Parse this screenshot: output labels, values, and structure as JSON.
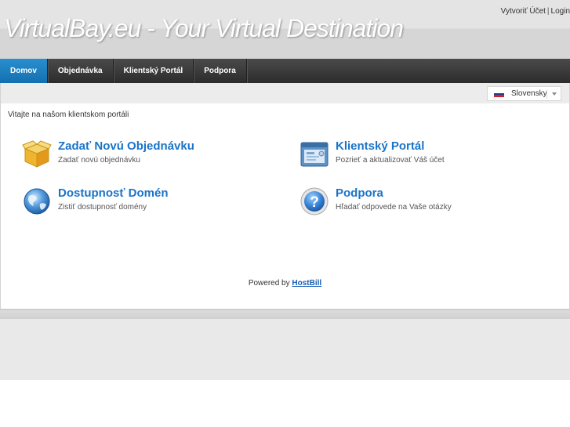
{
  "header": {
    "site_title": "VirtualBay.eu - Your Virtual Destination",
    "top_links": {
      "register": "Vytvoriť Účet",
      "separator": "|",
      "login": "Login"
    }
  },
  "nav": {
    "items": [
      {
        "label": "Domov",
        "active": true
      },
      {
        "label": "Objednávka",
        "active": false
      },
      {
        "label": "Klientský Portál",
        "active": false
      },
      {
        "label": "Podpora",
        "active": false
      }
    ]
  },
  "language": {
    "selected": "Slovensky",
    "flag_icon": "slovak-flag-icon"
  },
  "welcome": "Vitajte na našom klientskom portáli",
  "tiles": [
    {
      "title": "Zadať Novú Objednávku",
      "subtitle": "Zadať novú objednávku",
      "icon": "package-box-icon"
    },
    {
      "title": "Klientský Portál",
      "subtitle": "Pozrieť a aktualizovať Váš účet",
      "icon": "client-portal-icon"
    },
    {
      "title": "Dostupnosť Domén",
      "subtitle": "Zistiť dostupnosť domény",
      "icon": "globe-icon"
    },
    {
      "title": "Podpora",
      "subtitle": "Hľadať odpovede na Vaše otázky",
      "icon": "help-question-icon"
    }
  ],
  "footer": {
    "powered_by": "Powered by",
    "powered_link": "HostBill"
  },
  "colors": {
    "accent": "#1a74c8",
    "nav_active": "#1d7fc0",
    "nav_bg": "#333333"
  }
}
